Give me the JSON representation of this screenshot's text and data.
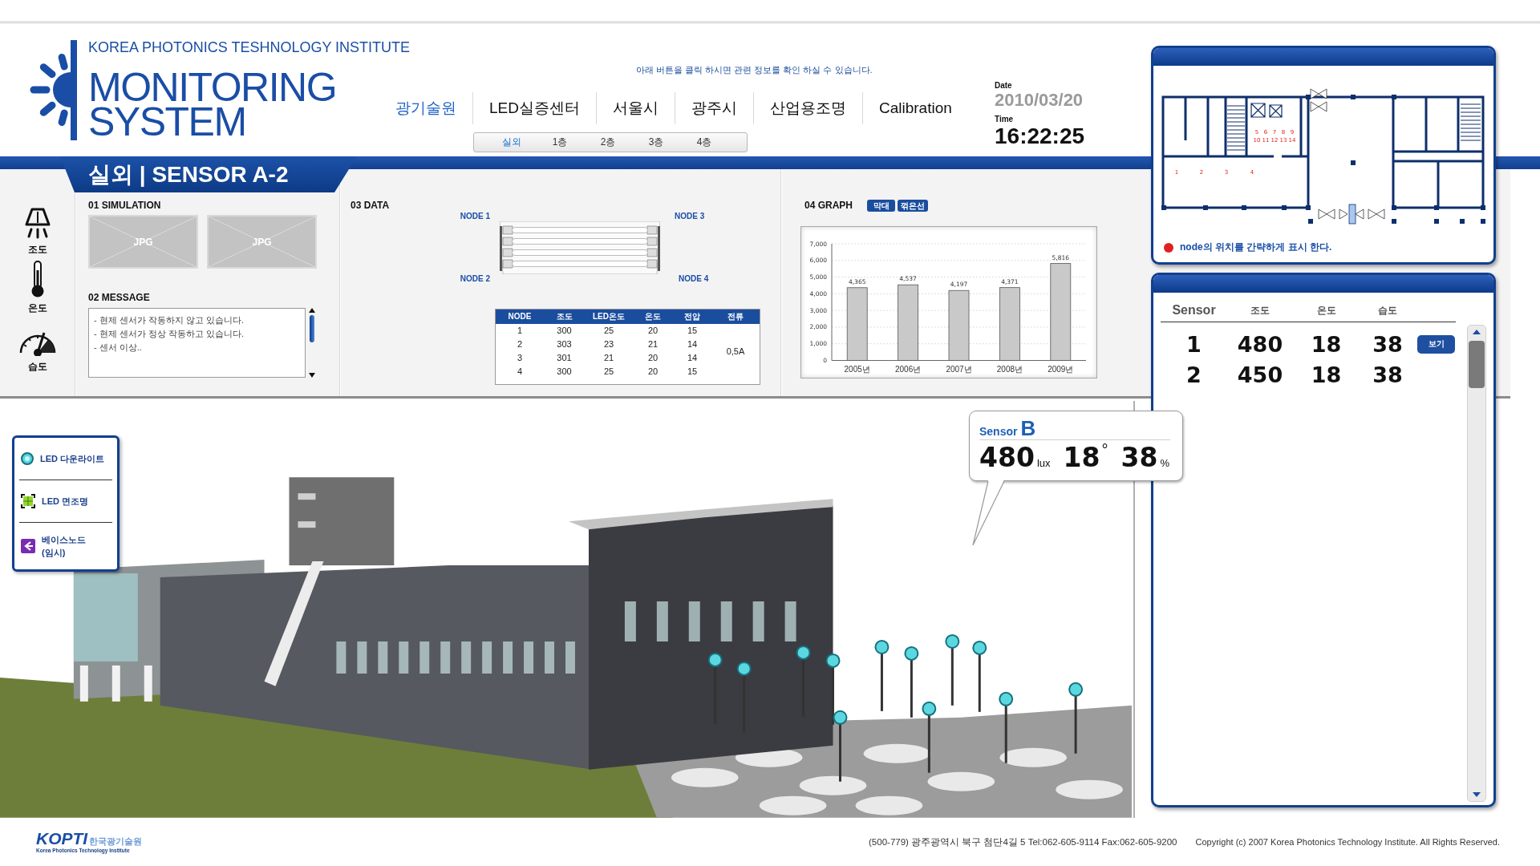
{
  "header": {
    "institute": "KOREA PHOTONICS TESHNOLOGY INSTITUTE",
    "title": "MONITORING SYSTEM",
    "hint": "아래 버튼을 클릭 하시면 관련 정보를 확인 하실 수 있습니다.",
    "date_label": "Date",
    "date": "2010/03/20",
    "time_label": "Time",
    "time": "16:22:25"
  },
  "nav": {
    "tabs": [
      {
        "label": "광기술원",
        "selected": true
      },
      {
        "label": "LED실증센터",
        "selected": false
      },
      {
        "label": "서울시",
        "selected": false
      },
      {
        "label": "광주시",
        "selected": false
      },
      {
        "label": "산업용조명",
        "selected": false
      },
      {
        "label": "Calibration",
        "selected": false
      }
    ],
    "subtabs": [
      {
        "label": "실외",
        "selected": true
      },
      {
        "label": "1층",
        "selected": false
      },
      {
        "label": "2층",
        "selected": false
      },
      {
        "label": "3층",
        "selected": false
      },
      {
        "label": "4층",
        "selected": false
      }
    ]
  },
  "page_title": "실외 | SENSOR A-2",
  "sidebar": {
    "items": [
      {
        "kind": "illuminance",
        "label": "조도"
      },
      {
        "kind": "temperature",
        "label": "온도"
      },
      {
        "kind": "humidity",
        "label": "습도"
      }
    ]
  },
  "simulation": {
    "title": "01 SIMULATION",
    "images": [
      {
        "label": "JPG"
      },
      {
        "label": "JPG"
      }
    ]
  },
  "message": {
    "title": "02 MESSAGE",
    "lines": [
      "- 현제 센서가 작동하지 않고 있습니다.",
      "- 현제 센서가 정상 작동하고 있습니다.",
      "- 센서 이상.."
    ]
  },
  "data": {
    "title": "03 DATA",
    "node_labels": [
      "NODE 1",
      "NODE 3",
      "NODE 2",
      "NODE 4"
    ],
    "table": {
      "columns": [
        "NODE",
        "조도",
        "LED온도",
        "온도",
        "전압",
        "전류"
      ],
      "rows": [
        [
          "1",
          "300",
          "25",
          "20",
          "15"
        ],
        [
          "2",
          "303",
          "23",
          "21",
          "14"
        ],
        [
          "3",
          "301",
          "21",
          "20",
          "14"
        ],
        [
          "4",
          "300",
          "25",
          "20",
          "15"
        ]
      ],
      "current": "0,5A"
    }
  },
  "graph": {
    "title": "04 GRAPH",
    "buttons": [
      "막대",
      "꺾은선"
    ],
    "chart_data": {
      "type": "bar",
      "categories": [
        "2005년",
        "2006년",
        "2007년",
        "2008년",
        "2009년"
      ],
      "values": [
        4365,
        4537,
        4197,
        4371,
        5816
      ],
      "value_labels": [
        "4,365",
        "4,537",
        "4,197",
        "4,371",
        "5,816"
      ],
      "ylim": [
        0,
        7000
      ],
      "yticks": [
        {
          "value": 0,
          "label": "0"
        },
        {
          "value": 1000,
          "label": "1,000"
        },
        {
          "value": 2000,
          "label": "2,000"
        },
        {
          "value": 3000,
          "label": "3,000"
        },
        {
          "value": 4000,
          "label": "4,000"
        },
        {
          "value": 5000,
          "label": "5,000"
        },
        {
          "value": 6000,
          "label": "6,000"
        },
        {
          "value": 7000,
          "label": "7,000"
        }
      ],
      "grid": true
    }
  },
  "scene": {
    "legend": [
      {
        "kind": "downlight",
        "label": "LED 다운라이트"
      },
      {
        "kind": "panel",
        "label": "LED 면조명"
      },
      {
        "kind": "base_node",
        "label": "베이스노드\n(임시)"
      }
    ],
    "callout": {
      "label": "Sensor",
      "name": "B",
      "readings": [
        {
          "kind": "illuminance",
          "value": "480",
          "unit": "lux"
        },
        {
          "kind": "temperature",
          "value": "18",
          "unit": "°"
        },
        {
          "kind": "humidity",
          "value": "38",
          "unit": "%"
        }
      ]
    }
  },
  "map": {
    "node_numbers": [
      "5",
      "6",
      "7",
      "8",
      "9",
      "10",
      "11",
      "12",
      "13",
      "14",
      "1",
      "2",
      "3",
      "4"
    ],
    "note": "node의 위치를 간략하게 표시 한다."
  },
  "sensors": {
    "columns": [
      "Sensor",
      "조도",
      "온도",
      "습도"
    ],
    "rows": [
      {
        "cells": [
          "1",
          "480",
          "18",
          "38"
        ],
        "action": "보기"
      },
      {
        "cells": [
          "2",
          "450",
          "18",
          "38"
        ]
      }
    ]
  },
  "footer": {
    "logo": "KOPTI",
    "logo_korean": "한국광기술원",
    "logo_subtitle": "Korea Photonics Technology Institute",
    "address": "(500-779) 광주광역시 북구 첨단4길 5 Tel:062-605-9114 Fax:062-605-9200",
    "copyright": "Copyright (c) 2007 Korea Photonics Technology Institute. All Rights Reserved."
  }
}
